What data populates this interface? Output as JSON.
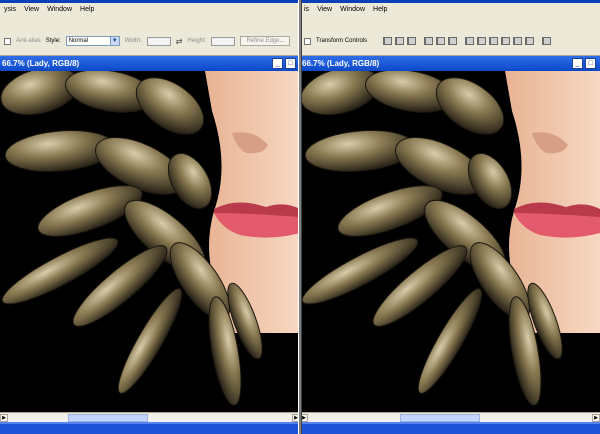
{
  "left": {
    "menu": [
      "ysis",
      "View",
      "Window",
      "Help"
    ],
    "options": {
      "anti_alias_label": "Anti-alias",
      "style_label": "Style:",
      "style_value": "Normal",
      "width_label": "Width:",
      "height_label": "Height:",
      "refine_label": "Refine Edge..."
    },
    "doc_title": "66.7% (Lady, RGB/8)"
  },
  "right": {
    "menu": [
      "is",
      "View",
      "Window",
      "Help"
    ],
    "options": {
      "transform_controls_label": "Transform Controls"
    },
    "doc_title": "66.7% (Lady, RGB/8)"
  },
  "colors": {
    "title_bar": "#0a48c9",
    "canvas_bg": "#000000",
    "feather_metal": "#8a7a52",
    "skin": "#f3c5aa",
    "lips": "#d9455a"
  }
}
